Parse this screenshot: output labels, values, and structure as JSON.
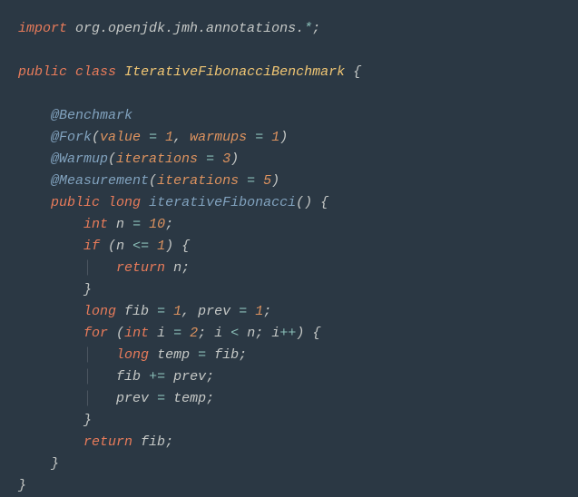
{
  "code": {
    "import_kw": "import",
    "import_pkg": "org.openjdk.jmh.annotations.",
    "import_star": "*",
    "public_kw": "public",
    "class_kw": "class",
    "class_name": "IterativeFibonacciBenchmark",
    "anno_benchmark": "@Benchmark",
    "anno_fork": "@Fork",
    "fork_value_param": "value",
    "fork_value_num": "1",
    "fork_warmups_param": "warmups",
    "fork_warmups_num": "1",
    "anno_warmup": "@Warmup",
    "warmup_iter_param": "iterations",
    "warmup_iter_num": "3",
    "anno_measurement": "@Measurement",
    "measure_iter_param": "iterations",
    "measure_iter_num": "5",
    "long_kw": "long",
    "method_name": "iterativeFibonacci",
    "int_kw": "int",
    "var_n": "n",
    "n_val": "10",
    "if_kw": "if",
    "leq_op": "<=",
    "one": "1",
    "return_kw": "return",
    "var_fib": "fib",
    "var_prev": "prev",
    "for_kw": "for",
    "var_i": "i",
    "two": "2",
    "lt_op": "<",
    "inc_op": "++",
    "var_temp": "temp",
    "plus_eq": "+=",
    "eq": "=",
    "comma": ",",
    "semi": ";",
    "lparen": "(",
    "rparen": ")",
    "lbrace": "{",
    "rbrace": "}"
  }
}
